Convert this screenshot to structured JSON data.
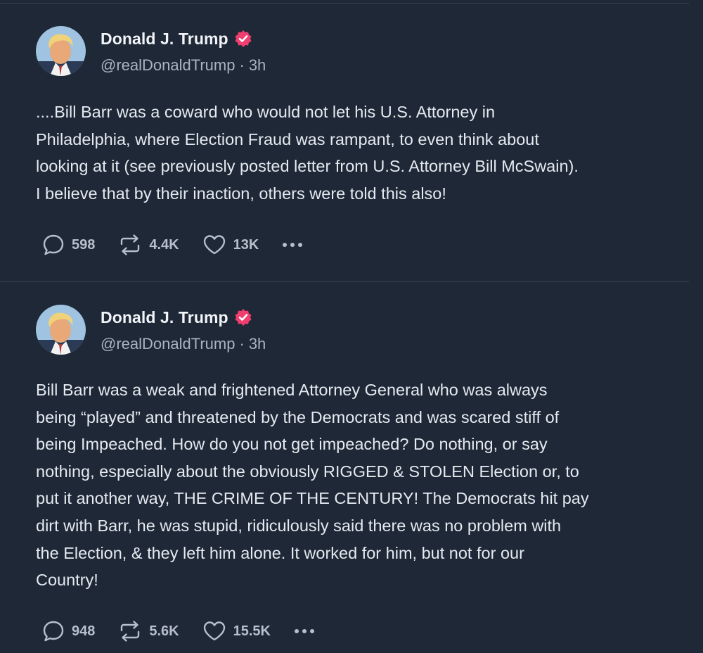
{
  "posts": [
    {
      "author": {
        "name": "Donald J. Trump",
        "handle": "@realDonaldTrump",
        "separator": "·",
        "time": "3h",
        "verified_icon": "verified-badge-icon",
        "verified_color": "#f03e6e"
      },
      "body_lines": [
        "....Bill Barr was a coward who would not let his U.S. Attorney in",
        "Philadelphia, where Election Fraud was rampant, to even think about",
        "looking at it (see previously posted letter from U.S. Attorney Bill McSwain).",
        "I believe that by their inaction, others were told this also!"
      ],
      "stats": {
        "replies": "598",
        "reposts": "4.4K",
        "likes": "13K"
      }
    },
    {
      "author": {
        "name": "Donald J. Trump",
        "handle": "@realDonaldTrump",
        "separator": "·",
        "time": "3h",
        "verified_icon": "verified-badge-icon",
        "verified_color": "#f03e6e"
      },
      "body_lines": [
        "Bill Barr was a weak and frightened Attorney General who was always",
        "being “played” and threatened by the Democrats and was scared stiff of",
        "being Impeached. How do you not get impeached? Do nothing, or say",
        "nothing, especially about the obviously RIGGED & STOLEN Election or, to",
        "put it another way, THE CRIME OF THE CENTURY! The Democrats hit pay",
        "dirt with Barr, he was stupid, ridiculously said there was no problem with",
        "the Election, & they left him alone. It worked for him, but not for our",
        "Country!"
      ],
      "stats": {
        "replies": "948",
        "reposts": "5.6K",
        "likes": "15.5K"
      }
    }
  ],
  "theme": {
    "background": "#1e2837",
    "divider": "#3a4454",
    "text": "#e6eaf0",
    "muted": "#a9b3c1"
  },
  "icons": {
    "reply": "reply-icon",
    "repost": "repost-icon",
    "like": "heart-icon",
    "more": "more-dots-icon"
  }
}
